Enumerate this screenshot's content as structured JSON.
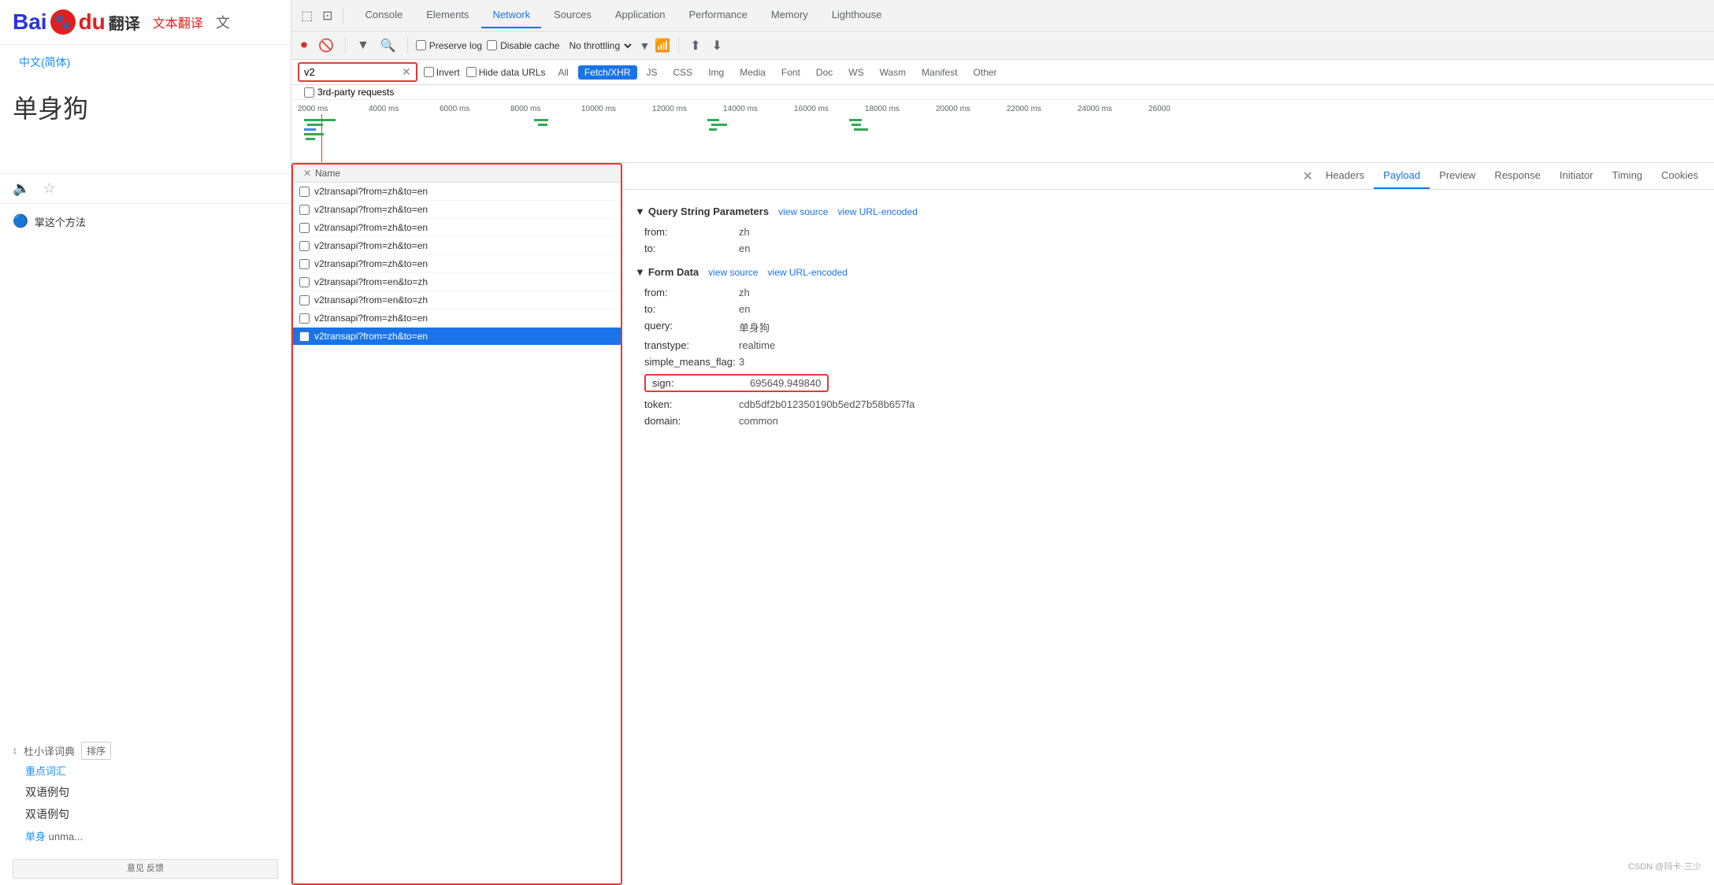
{
  "baidu": {
    "logo_bai": "Bai",
    "logo_du": "du",
    "title": "翻译",
    "nav_translate": "文本翻译",
    "translate_icon": "文",
    "lang_source": "中文(简体)",
    "source_text": "单身狗",
    "result_label": "掌这个方法",
    "dict_label": "杜小译词典",
    "sort_btn": "排序",
    "keyword1": "重点词汇",
    "bilingual": "双语例句",
    "bilingual2": "双语例句",
    "example_word": "单身",
    "example_rest": "unma...",
    "feedback": "意见\n反馈",
    "csdn": "CSDN @玛卡·三少"
  },
  "devtools": {
    "tabs": [
      "Console",
      "Elements",
      "Network",
      "Sources",
      "Application",
      "Performance",
      "Memory",
      "Lighthouse"
    ],
    "active_tab": "Network",
    "icons": [
      "⬆",
      "⬆",
      "✕",
      "⊡"
    ]
  },
  "network_toolbar": {
    "record_icon": "⏺",
    "clear_icon": "🚫",
    "filter_icon": "▼",
    "search_icon": "🔍",
    "preserve_log_label": "Preserve log",
    "disable_cache_label": "Disable cache",
    "throttle_value": "No throttling",
    "upload_icon": "⬆",
    "download_icon": "⬇"
  },
  "filter_bar": {
    "input_value": "v2",
    "invert_label": "Invert",
    "hide_data_urls_label": "Hide data URLs",
    "type_buttons": [
      "All",
      "Fetch/XHR",
      "JS",
      "CSS",
      "Img",
      "Media",
      "Font",
      "Doc",
      "WS",
      "Wasm",
      "Manifest",
      "Other"
    ],
    "active_type": "Fetch/XHR"
  },
  "third_party": {
    "label": "3rd-party requests"
  },
  "timeline": {
    "labels": [
      "2000 ms",
      "4000 ms",
      "6000 ms",
      "8000 ms",
      "10000 ms",
      "12000 ms",
      "14000 ms",
      "16000 ms",
      "18000 ms",
      "20000 ms",
      "22000 ms",
      "24000 ms",
      "26000"
    ]
  },
  "network_list": {
    "col_name": "Name",
    "items": [
      {
        "name": "v2transapi?from=zh&to=en",
        "selected": false
      },
      {
        "name": "v2transapi?from=zh&to=en",
        "selected": false
      },
      {
        "name": "v2transapi?from=zh&to=en",
        "selected": false
      },
      {
        "name": "v2transapi?from=zh&to=en",
        "selected": false
      },
      {
        "name": "v2transapi?from=zh&to=en",
        "selected": false
      },
      {
        "name": "v2transapi?from=en&to=zh",
        "selected": false
      },
      {
        "name": "v2transapi?from=en&to=zh",
        "selected": false
      },
      {
        "name": "v2transapi?from=zh&to=en",
        "selected": false
      },
      {
        "name": "v2transapi?from=zh&to=en",
        "selected": true
      }
    ]
  },
  "detail": {
    "tabs": [
      "Headers",
      "Payload",
      "Preview",
      "Response",
      "Initiator",
      "Timing",
      "Cookies"
    ],
    "active_tab": "Payload",
    "query_string": {
      "section_title": "Query String Parameters",
      "view_source_link": "view source",
      "view_url_encoded_link": "view URL-encoded",
      "params": [
        {
          "key": "from",
          "value": "zh"
        },
        {
          "key": "to",
          "value": "en"
        }
      ]
    },
    "form_data": {
      "section_title": "Form Data",
      "view_source_link": "view source",
      "view_url_encoded_link": "view URL-encoded",
      "params": [
        {
          "key": "from",
          "value": "zh"
        },
        {
          "key": "to",
          "value": "en"
        },
        {
          "key": "query",
          "value": "单身狗"
        },
        {
          "key": "transtype",
          "value": "realtime"
        },
        {
          "key": "simple_means_flag",
          "value": "3"
        },
        {
          "key": "sign",
          "value": "695649.949840"
        },
        {
          "key": "token",
          "value": "cdb5df2b012350190b5ed27b58b657fa"
        },
        {
          "key": "domain",
          "value": "common"
        }
      ]
    }
  }
}
